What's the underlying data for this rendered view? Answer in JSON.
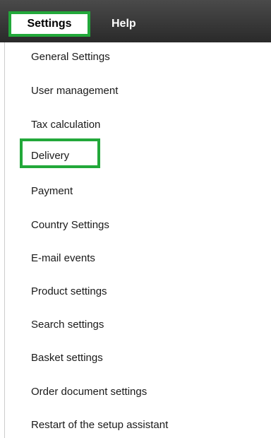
{
  "menubar": {
    "settings_label": "Settings",
    "help_label": "Help"
  },
  "dropdown": {
    "items": [
      "General Settings",
      "User management",
      "Tax calculation",
      "Delivery",
      "Payment",
      "Country Settings",
      "E-mail events",
      "Product settings",
      "Search settings",
      "Basket settings",
      "Order document settings",
      "Restart of the setup assistant"
    ]
  },
  "colors": {
    "highlight": "#22a83a",
    "menubar": "#3a3a3a"
  }
}
